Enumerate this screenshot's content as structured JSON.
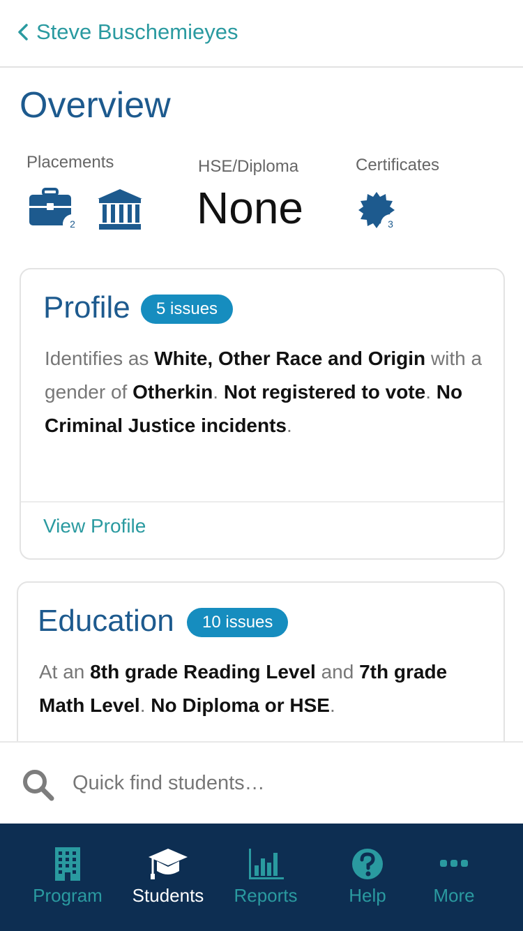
{
  "nav": {
    "back_label": "Steve Buschemieyes"
  },
  "overview": {
    "title": "Overview",
    "placements_label": "Placements",
    "placements_count": "2",
    "hse_label": "HSE/Diploma",
    "hse_value": "None",
    "certificates_label": "Certificates",
    "certificates_count": "3"
  },
  "profile": {
    "title": "Profile",
    "issues": "5 issues",
    "t1": "Identifies as ",
    "b1": "White, Other Race and Origin",
    "t2": " with a gender of ",
    "b2": "Otherkin",
    "t3": ". ",
    "b3": "Not registered to vote",
    "t4": ". ",
    "b4": "No Criminal Justice incidents",
    "t5": ".",
    "link": "View Profile"
  },
  "education": {
    "title": "Education",
    "issues": "10 issues",
    "t1": "At an ",
    "b1": "8th grade Reading Level",
    "t2": " and ",
    "b2": "7th grade Math Level",
    "t3": ". ",
    "b3": "No Diploma or HSE",
    "t4": "."
  },
  "search": {
    "placeholder": "Quick find students…"
  },
  "tabs": [
    {
      "label": "Program",
      "icon": "building-icon"
    },
    {
      "label": "Students",
      "icon": "graduation-cap-icon"
    },
    {
      "label": "Reports",
      "icon": "bar-chart-icon"
    },
    {
      "label": "Help",
      "icon": "help-icon"
    },
    {
      "label": "More",
      "icon": "more-icon"
    }
  ],
  "colors": {
    "accent": "#2a9aa0",
    "brand": "#1d5a8e",
    "tabbar": "#0d2e52",
    "pill": "#168dbf"
  }
}
